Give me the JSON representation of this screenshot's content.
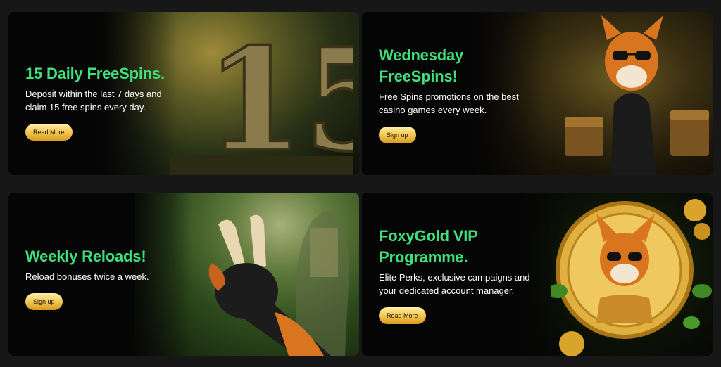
{
  "cards": [
    {
      "title": "15 Daily FreeSpins.",
      "description_lines": [
        "Deposit within the last 7 days and",
        "claim 15 free spins every day."
      ],
      "button": "Read More",
      "art_text": "15"
    },
    {
      "title_lines": [
        "Wednesday",
        "FreeSpins!"
      ],
      "description_lines": [
        "Free Spins promotions on the best",
        "casino games every week."
      ],
      "button": "Sign up"
    },
    {
      "title": "Weekly Reloads!",
      "description_lines": [
        "Reload bonuses twice a week."
      ],
      "button": "Sign up"
    },
    {
      "title_lines": [
        "FoxyGold VIP",
        "Programme."
      ],
      "description_lines": [
        "Elite Perks, exclusive campaigns and",
        "your dedicated account manager."
      ],
      "button": "Read More"
    }
  ],
  "colors": {
    "title": "#3fe07c",
    "button": "#f1c24d",
    "background": "#171717"
  },
  "icons": [
    "stone-15-sculpture",
    "fox-sunglasses-character",
    "peace-sign-paw",
    "gold-fox-coin"
  ]
}
